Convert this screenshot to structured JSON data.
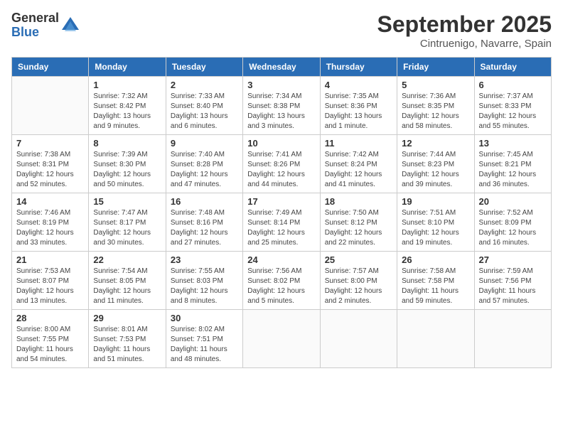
{
  "logo": {
    "general": "General",
    "blue": "Blue"
  },
  "title": "September 2025",
  "subtitle": "Cintruenigo, Navarre, Spain",
  "weekdays": [
    "Sunday",
    "Monday",
    "Tuesday",
    "Wednesday",
    "Thursday",
    "Friday",
    "Saturday"
  ],
  "weeks": [
    [
      {
        "day": "",
        "info": ""
      },
      {
        "day": "1",
        "info": "Sunrise: 7:32 AM\nSunset: 8:42 PM\nDaylight: 13 hours\nand 9 minutes."
      },
      {
        "day": "2",
        "info": "Sunrise: 7:33 AM\nSunset: 8:40 PM\nDaylight: 13 hours\nand 6 minutes."
      },
      {
        "day": "3",
        "info": "Sunrise: 7:34 AM\nSunset: 8:38 PM\nDaylight: 13 hours\nand 3 minutes."
      },
      {
        "day": "4",
        "info": "Sunrise: 7:35 AM\nSunset: 8:36 PM\nDaylight: 13 hours\nand 1 minute."
      },
      {
        "day": "5",
        "info": "Sunrise: 7:36 AM\nSunset: 8:35 PM\nDaylight: 12 hours\nand 58 minutes."
      },
      {
        "day": "6",
        "info": "Sunrise: 7:37 AM\nSunset: 8:33 PM\nDaylight: 12 hours\nand 55 minutes."
      }
    ],
    [
      {
        "day": "7",
        "info": "Sunrise: 7:38 AM\nSunset: 8:31 PM\nDaylight: 12 hours\nand 52 minutes."
      },
      {
        "day": "8",
        "info": "Sunrise: 7:39 AM\nSunset: 8:30 PM\nDaylight: 12 hours\nand 50 minutes."
      },
      {
        "day": "9",
        "info": "Sunrise: 7:40 AM\nSunset: 8:28 PM\nDaylight: 12 hours\nand 47 minutes."
      },
      {
        "day": "10",
        "info": "Sunrise: 7:41 AM\nSunset: 8:26 PM\nDaylight: 12 hours\nand 44 minutes."
      },
      {
        "day": "11",
        "info": "Sunrise: 7:42 AM\nSunset: 8:24 PM\nDaylight: 12 hours\nand 41 minutes."
      },
      {
        "day": "12",
        "info": "Sunrise: 7:44 AM\nSunset: 8:23 PM\nDaylight: 12 hours\nand 39 minutes."
      },
      {
        "day": "13",
        "info": "Sunrise: 7:45 AM\nSunset: 8:21 PM\nDaylight: 12 hours\nand 36 minutes."
      }
    ],
    [
      {
        "day": "14",
        "info": "Sunrise: 7:46 AM\nSunset: 8:19 PM\nDaylight: 12 hours\nand 33 minutes."
      },
      {
        "day": "15",
        "info": "Sunrise: 7:47 AM\nSunset: 8:17 PM\nDaylight: 12 hours\nand 30 minutes."
      },
      {
        "day": "16",
        "info": "Sunrise: 7:48 AM\nSunset: 8:16 PM\nDaylight: 12 hours\nand 27 minutes."
      },
      {
        "day": "17",
        "info": "Sunrise: 7:49 AM\nSunset: 8:14 PM\nDaylight: 12 hours\nand 25 minutes."
      },
      {
        "day": "18",
        "info": "Sunrise: 7:50 AM\nSunset: 8:12 PM\nDaylight: 12 hours\nand 22 minutes."
      },
      {
        "day": "19",
        "info": "Sunrise: 7:51 AM\nSunset: 8:10 PM\nDaylight: 12 hours\nand 19 minutes."
      },
      {
        "day": "20",
        "info": "Sunrise: 7:52 AM\nSunset: 8:09 PM\nDaylight: 12 hours\nand 16 minutes."
      }
    ],
    [
      {
        "day": "21",
        "info": "Sunrise: 7:53 AM\nSunset: 8:07 PM\nDaylight: 12 hours\nand 13 minutes."
      },
      {
        "day": "22",
        "info": "Sunrise: 7:54 AM\nSunset: 8:05 PM\nDaylight: 12 hours\nand 11 minutes."
      },
      {
        "day": "23",
        "info": "Sunrise: 7:55 AM\nSunset: 8:03 PM\nDaylight: 12 hours\nand 8 minutes."
      },
      {
        "day": "24",
        "info": "Sunrise: 7:56 AM\nSunset: 8:02 PM\nDaylight: 12 hours\nand 5 minutes."
      },
      {
        "day": "25",
        "info": "Sunrise: 7:57 AM\nSunset: 8:00 PM\nDaylight: 12 hours\nand 2 minutes."
      },
      {
        "day": "26",
        "info": "Sunrise: 7:58 AM\nSunset: 7:58 PM\nDaylight: 11 hours\nand 59 minutes."
      },
      {
        "day": "27",
        "info": "Sunrise: 7:59 AM\nSunset: 7:56 PM\nDaylight: 11 hours\nand 57 minutes."
      }
    ],
    [
      {
        "day": "28",
        "info": "Sunrise: 8:00 AM\nSunset: 7:55 PM\nDaylight: 11 hours\nand 54 minutes."
      },
      {
        "day": "29",
        "info": "Sunrise: 8:01 AM\nSunset: 7:53 PM\nDaylight: 11 hours\nand 51 minutes."
      },
      {
        "day": "30",
        "info": "Sunrise: 8:02 AM\nSunset: 7:51 PM\nDaylight: 11 hours\nand 48 minutes."
      },
      {
        "day": "",
        "info": ""
      },
      {
        "day": "",
        "info": ""
      },
      {
        "day": "",
        "info": ""
      },
      {
        "day": "",
        "info": ""
      }
    ]
  ]
}
